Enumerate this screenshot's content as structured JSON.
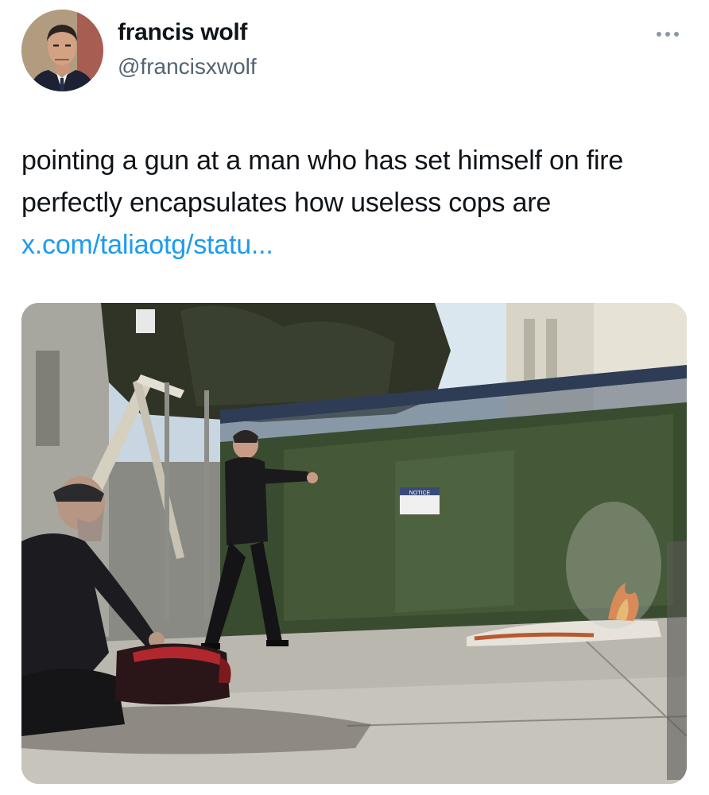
{
  "author": {
    "display_name": "francis wolf",
    "handle": "@francisxwolf"
  },
  "more_icon": "more-horizontal-icon",
  "tweet": {
    "text": "pointing a gun at a man who has set himself on fire perfectly encapsulates how useless cops are ",
    "link_text": "x.com/taliaotg/statu..."
  },
  "media": {
    "sign_text": "NOTICE"
  },
  "colors": {
    "text": "#0f1419",
    "secondary": "#536471",
    "link": "#1d9bf0"
  }
}
